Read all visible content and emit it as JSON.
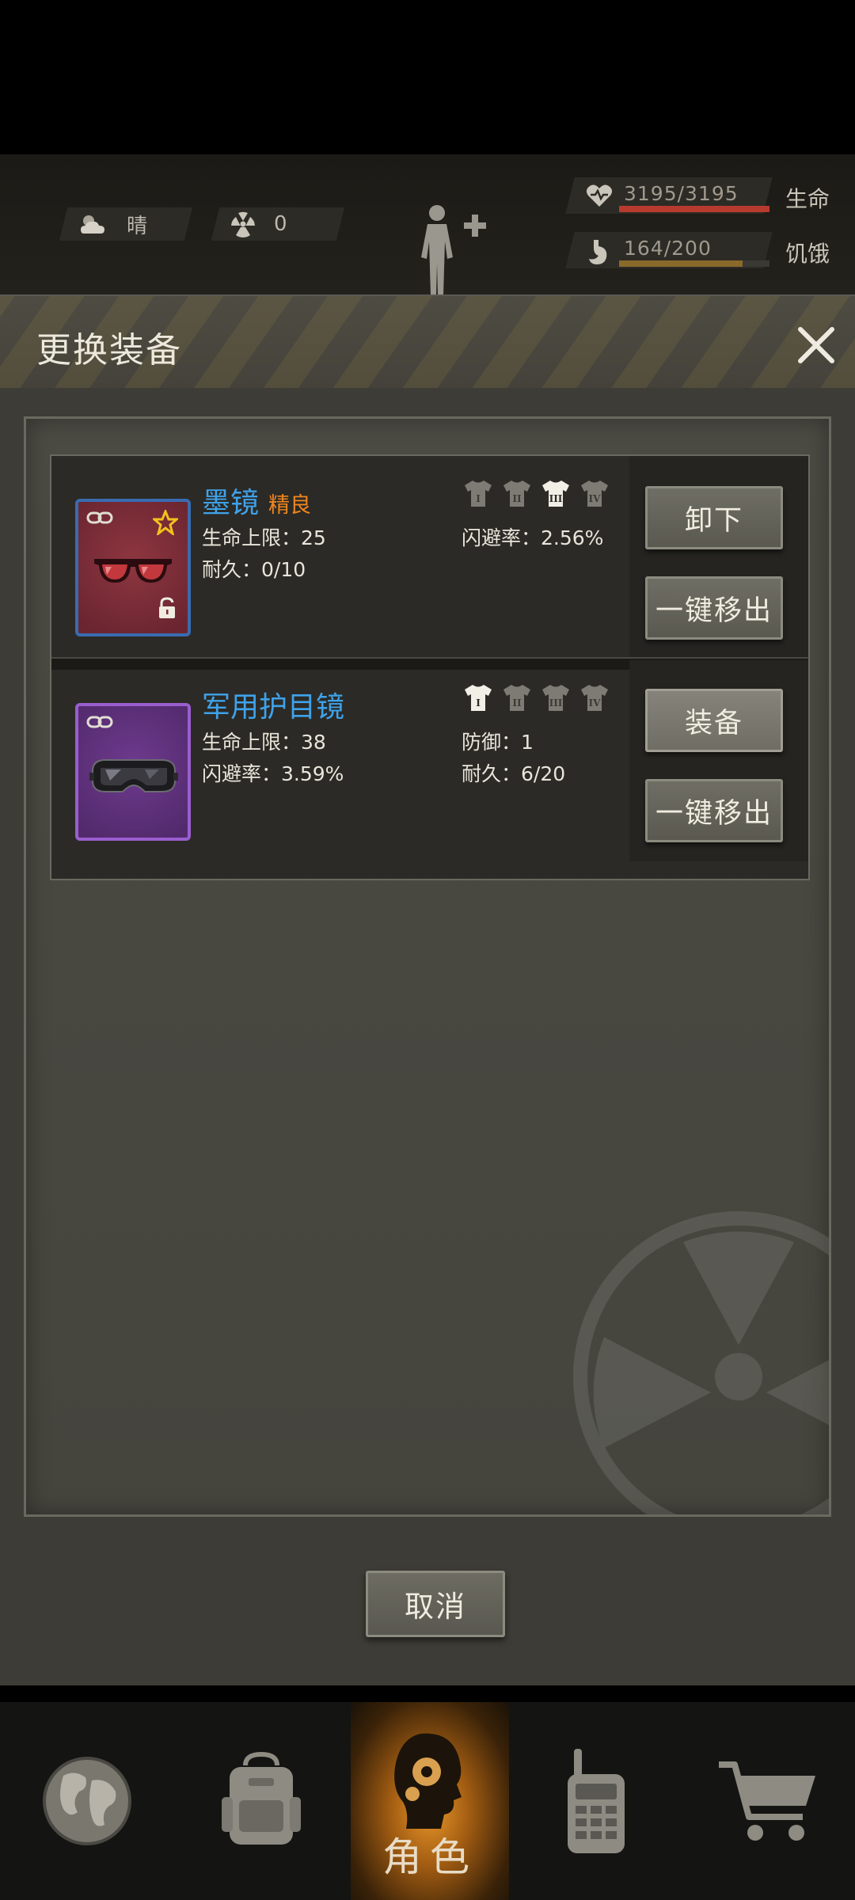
{
  "hud": {
    "weather": {
      "icon": "cloud-sun-icon",
      "label": "晴"
    },
    "radiation": {
      "icon": "radiation-icon",
      "value": "0"
    },
    "stats": [
      {
        "icon": "heart-icon",
        "value": "3195/3195",
        "label": "生命",
        "color": "#b83a2e",
        "fill": 1.0
      },
      {
        "icon": "stomach-icon",
        "value": "164/200",
        "label": "饥饿",
        "color": "#8a6a2a",
        "fill": 0.82
      }
    ]
  },
  "dialog": {
    "title": "更换装备",
    "close_icon": "close-icon",
    "items": [
      {
        "name": "墨镜",
        "quality": "精良",
        "icon": "sunglasses-icon",
        "frame_color": "#3a6bb0",
        "bg_color": "#7a2a33",
        "favorite": true,
        "locked": true,
        "attrs_left": [
          "生命上限：25",
          "耐久：0/10"
        ],
        "attrs_right": [
          "闪避率：2.56%"
        ],
        "slot_marks": [
          "I",
          "II",
          "III",
          "IV"
        ],
        "active_slot": 2,
        "primary_action": "卸下",
        "secondary_action": "一键移出"
      },
      {
        "name": "军用护目镜",
        "quality": "",
        "icon": "goggles-icon",
        "frame_color": "#8c4fc0",
        "bg_color": "#5c2d7a",
        "favorite": false,
        "locked": false,
        "attrs_left": [
          "生命上限：38",
          "闪避率：3.59%"
        ],
        "attrs_right": [
          "防御：1",
          "耐久：6/20"
        ],
        "slot_marks": [
          "I",
          "II",
          "III",
          "IV"
        ],
        "active_slot": 0,
        "primary_action": "装备",
        "secondary_action": "一键移出"
      }
    ],
    "cancel_label": "取消"
  },
  "nav": {
    "tabs": [
      {
        "icon": "globe-icon",
        "label": ""
      },
      {
        "icon": "backpack-icon",
        "label": ""
      },
      {
        "icon": "character-icon",
        "label": "角色",
        "active": true
      },
      {
        "icon": "radio-icon",
        "label": ""
      },
      {
        "icon": "cart-icon",
        "label": ""
      }
    ]
  }
}
